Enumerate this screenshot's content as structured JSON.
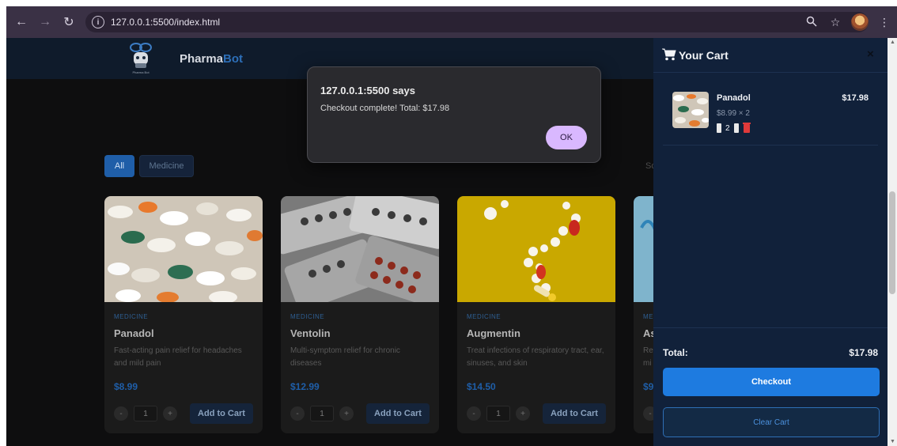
{
  "browser": {
    "url": "127.0.0.1:5500/index.html",
    "back_icon": "arrow-left-icon",
    "forward_icon": "arrow-right-icon",
    "reload_icon": "reload-icon",
    "zoom_icon": "zoom-icon",
    "bookmark_icon": "star-icon",
    "menu_icon": "kebab-menu-icon"
  },
  "site": {
    "brand_prefix": "Pharma",
    "brand_suffix": "Bot",
    "logo_text": "Pharma Bot"
  },
  "filters": {
    "all": "All",
    "medicine": "Medicine",
    "sort_peek": "So"
  },
  "products": [
    {
      "category": "MEDICINE",
      "name": "Panadol",
      "description": "Fast-acting pain relief for headaches and mild pain",
      "price": "$8.99",
      "qty": "1",
      "minus": "-",
      "plus": "+",
      "add_label": "Add to Cart"
    },
    {
      "category": "MEDICINE",
      "name": "Ventolin",
      "description": "Multi-symptom relief for chronic diseases",
      "price": "$12.99",
      "qty": "1",
      "minus": "-",
      "plus": "+",
      "add_label": "Add to Cart"
    },
    {
      "category": "MEDICINE",
      "name": "Augmentin",
      "description": "Treat infections of respiratory tract, ear, sinuses, and skin",
      "price": "$14.50",
      "qty": "1",
      "minus": "-",
      "plus": "+",
      "add_label": "Add to Cart"
    },
    {
      "category": "ME",
      "name": "As",
      "description": "Rel mi",
      "price": "$9",
      "minus": "-"
    }
  ],
  "dialog": {
    "title": "127.0.0.1:5500 says",
    "message": "Checkout complete! Total: $17.98",
    "ok_label": "OK"
  },
  "cart": {
    "title": "Your Cart",
    "close_symbol": "×",
    "item": {
      "name": "Panadol",
      "unit_line": "$8.99 × 2",
      "qty": "2",
      "line_total": "$17.98"
    },
    "total_label": "Total:",
    "total_value": "$17.98",
    "checkout_label": "Checkout",
    "clear_label": "Clear Cart"
  },
  "colors": {
    "accent": "#1e7be0",
    "header_bg": "#0f1b2b",
    "cart_bg": "#11213a",
    "dialog_ok": "#d9b8ff"
  }
}
